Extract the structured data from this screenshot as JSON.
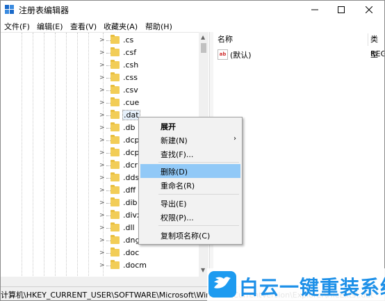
{
  "window": {
    "title": "注册表编辑器",
    "controls": {
      "minimize": "—",
      "maximize": "☐",
      "close": "✕"
    }
  },
  "menubar": [
    {
      "label": "文件(F)"
    },
    {
      "label": "编辑(E)"
    },
    {
      "label": "查看(V)"
    },
    {
      "label": "收藏夹(A)"
    },
    {
      "label": "帮助(H)"
    }
  ],
  "tree": {
    "items": [
      {
        "label": ".cs"
      },
      {
        "label": ".csf"
      },
      {
        "label": ".csh"
      },
      {
        "label": ".css"
      },
      {
        "label": ".csv"
      },
      {
        "label": ".cue"
      },
      {
        "label": ".dat",
        "selected": true
      },
      {
        "label": ".db"
      },
      {
        "label": ".dcp"
      },
      {
        "label": ".dcp"
      },
      {
        "label": ".dcr"
      },
      {
        "label": ".dds"
      },
      {
        "label": ".dff"
      },
      {
        "label": ".dib"
      },
      {
        "label": ".divx"
      },
      {
        "label": ".dll"
      },
      {
        "label": ".dng"
      },
      {
        "label": ".doc"
      },
      {
        "label": ".docm"
      }
    ]
  },
  "details": {
    "columns": {
      "name": "名称",
      "type": "类型"
    },
    "rows": [
      {
        "name": "(默认)",
        "type": "REG",
        "icon": "ab-string-icon"
      }
    ]
  },
  "status_bar": {
    "path": "计算机\\HKEY_CURRENT_USER\\SOFTWARE\\Microsoft\\Windows\\CurrentVersion\\Explorer\\FileExts\\.dat"
  },
  "context_menu": {
    "items": [
      {
        "label": "展开",
        "bold": true
      },
      {
        "label": "新建(N)",
        "submenu": true
      },
      {
        "label": "查找(F)..."
      },
      {
        "label": "删除(D)",
        "highlighted": true
      },
      {
        "label": "重命名(R)"
      },
      {
        "label": "导出(E)"
      },
      {
        "label": "权限(P)..."
      },
      {
        "label": "复制项名称(C)"
      }
    ]
  },
  "watermark": {
    "text": "白云一键重装系统"
  },
  "colors": {
    "highlight": "#91c9f7",
    "folder": "#f2cd57",
    "brand": "#1d90e8"
  }
}
